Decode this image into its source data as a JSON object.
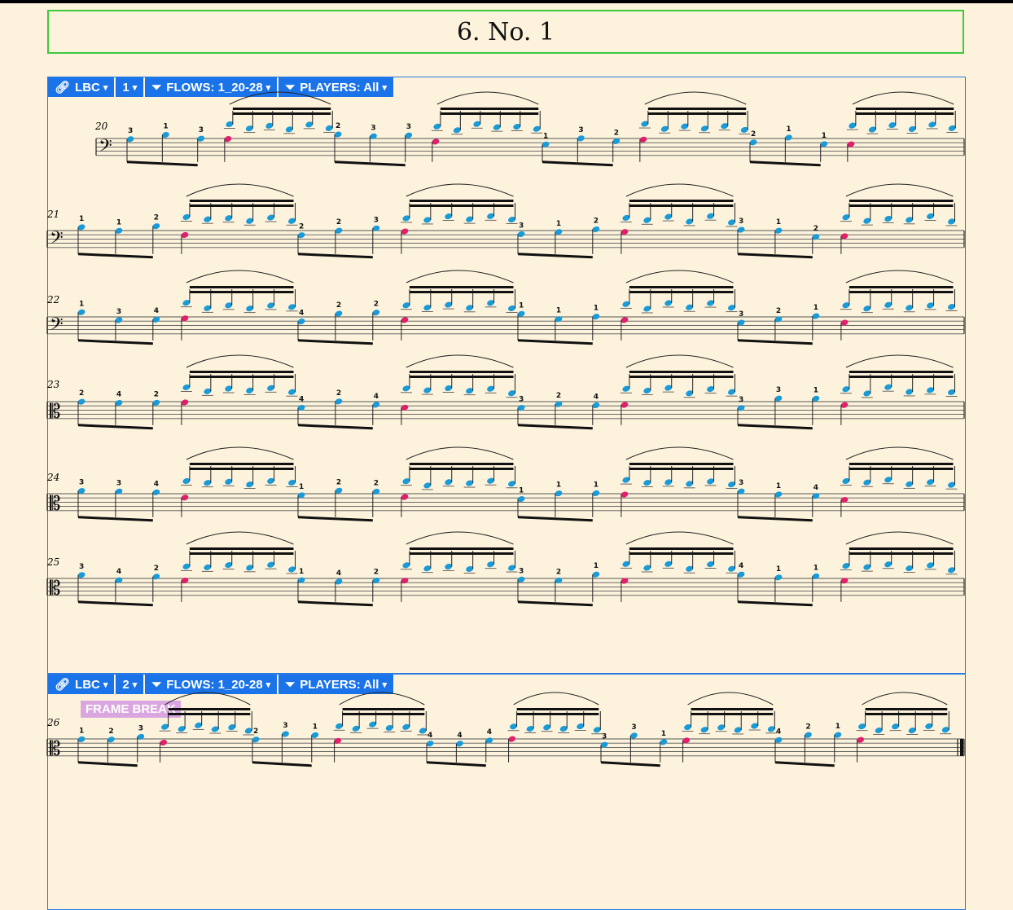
{
  "title": "6. No. 1",
  "frame1": {
    "link_label": "LBC",
    "number_label": "1",
    "flows_label": "FLOWS: 1_20-28",
    "players_label": "PLAYERS: All"
  },
  "frame2": {
    "link_label": "LBC",
    "number_label": "2",
    "flows_label": "FLOWS: 1_20-28",
    "players_label": "PLAYERS: All",
    "break_label": "FRAME BREAK"
  },
  "measures": [
    "20",
    "21",
    "22",
    "23",
    "24",
    "25",
    "26"
  ],
  "colors": {
    "note": "#1a9bd8",
    "accent_note": "#e0206a",
    "frame": "#2a7ae2",
    "title_frame": "#3fc93f",
    "paper": "#fdf3dc"
  }
}
